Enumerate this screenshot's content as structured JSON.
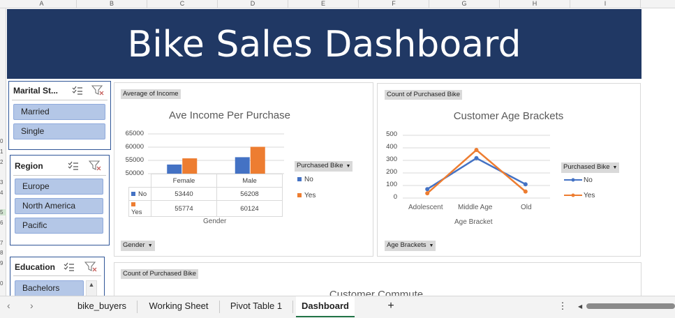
{
  "columns": [
    "A",
    "B",
    "C",
    "D",
    "E",
    "F",
    "G",
    "H",
    "I"
  ],
  "rows": [
    "0",
    "1",
    "2",
    "3",
    "4",
    "5",
    "6",
    "7",
    "8",
    "9",
    "0"
  ],
  "dashboard_title": "Bike Sales Dashboard",
  "slicers": {
    "marital": {
      "title": "Marital St...",
      "items": [
        "Married",
        "Single"
      ]
    },
    "region": {
      "title": "Region",
      "items": [
        "Europe",
        "North America",
        "Pacific"
      ]
    },
    "education": {
      "title": "Education",
      "items": [
        "Bachelors"
      ]
    }
  },
  "income_chart": {
    "field_tag": "Average of Income",
    "title": "Ave Income Per Purchase",
    "y_ticks": [
      "65000",
      "60000",
      "55000",
      "50000"
    ],
    "xlabel": "Gender",
    "legend_tag": "Purchased Bike",
    "legend": [
      "No",
      "Yes"
    ],
    "axis_button": "Gender",
    "table_rows": [
      {
        "label": "No",
        "values": [
          "53440",
          "56208"
        ]
      },
      {
        "label": "Yes",
        "values": [
          "55774",
          "60124"
        ]
      }
    ]
  },
  "age_chart": {
    "field_tag": "Count of Purchased Bike",
    "title": "Customer Age Brackets",
    "y_ticks": [
      "500",
      "400",
      "300",
      "200",
      "100",
      "0"
    ],
    "xlabel": "Age Bracket",
    "legend_tag": "Purchased Bike",
    "legend": [
      "No",
      "Yes"
    ],
    "axis_button": "Age Brackets"
  },
  "commute_chart": {
    "field_tag": "Count of Purchased Bike",
    "title": "Customer Commute"
  },
  "sheet_tabs": [
    "bike_buyers",
    "Working Sheet",
    "Pivot Table 1",
    "Dashboard"
  ],
  "add_tab": "+",
  "more_icon": "⋮",
  "colors": {
    "no": "#4472c4",
    "yes": "#ed7d31",
    "banner": "#203864",
    "slicer_item": "#b4c7e7"
  },
  "chart_data": [
    {
      "type": "bar",
      "title": "Ave Income Per Purchase",
      "xlabel": "Gender",
      "ylabel": "",
      "categories": [
        "Female",
        "Male"
      ],
      "series": [
        {
          "name": "No",
          "values": [
            53440,
            56208
          ]
        },
        {
          "name": "Yes",
          "values": [
            55774,
            60124
          ]
        }
      ],
      "ylim": [
        50000,
        65000
      ],
      "legend": "right"
    },
    {
      "type": "line",
      "title": "Customer Age Brackets",
      "xlabel": "Age Bracket",
      "ylabel": "",
      "categories": [
        "Adolescent",
        "Middle Age",
        "Old"
      ],
      "series": [
        {
          "name": "No",
          "values": [
            71,
            318,
            110
          ]
        },
        {
          "name": "Yes",
          "values": [
            38,
            383,
            52
          ]
        }
      ],
      "ylim": [
        0,
        500
      ],
      "legend": "right"
    }
  ]
}
